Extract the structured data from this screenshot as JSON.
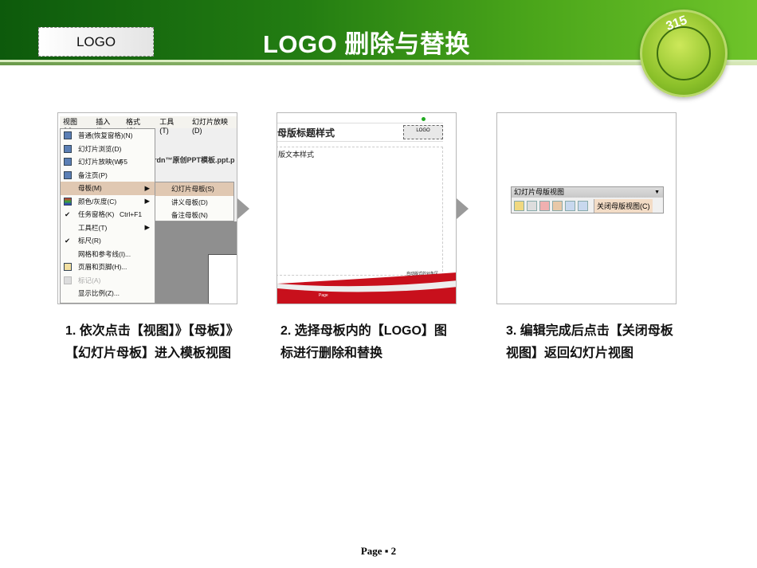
{
  "header": {
    "title": "LOGO 删除与替换",
    "logo_placeholder": "LOGO",
    "emblem_text": "315"
  },
  "steps": [
    {
      "caption": "1. 依次点击【视图】》【母板】》【幻灯片母板】进入模板视图"
    },
    {
      "caption": "2. 选择母板内的【LOGO】图标进行删除和替换"
    },
    {
      "caption": "3. 编辑完成后点击【关闭母板视图】返回幻灯片视图"
    }
  ],
  "panel1": {
    "menubar": [
      "视图(V)",
      "插入(I)",
      "格式(O)",
      "工具(T)",
      "幻灯片放映(D)"
    ],
    "file_title": "rdn™原创PPT模板.ppt.p",
    "menu": [
      {
        "label": "普通(恢复窗格)(N)"
      },
      {
        "label": "幻灯片浏览(D)"
      },
      {
        "label": "幻灯片放映(W)",
        "shortcut": "F5"
      },
      {
        "label": "备注页(P)"
      },
      {
        "label": "母板(M)",
        "submenu": "▶"
      },
      {
        "label": "颜色/灰度(C)",
        "submenu": "▶"
      },
      {
        "label": "任务窗格(K)",
        "shortcut": "Ctrl+F1"
      },
      {
        "label": "工具栏(T)",
        "submenu": "▶"
      },
      {
        "label": "标尺(R)"
      },
      {
        "label": "网格和参考线(I)..."
      },
      {
        "label": "页眉和页脚(H)..."
      },
      {
        "label": "标记(A)"
      },
      {
        "label": "显示比例(Z)..."
      }
    ],
    "submenu": [
      "幻灯片母板(S)",
      "讲义母板(D)",
      "备注母板(N)"
    ]
  },
  "panel2": {
    "title": "母版标题样式",
    "body": "版文本样式",
    "logo": "LOGO",
    "note": "自动版式的对象区",
    "footer": "Page"
  },
  "panel3": {
    "toolbar_title": "幻灯片母版视图",
    "close_label": "关闭母版视图(C)"
  },
  "footer": {
    "page_label": "Page ▪ 2"
  }
}
